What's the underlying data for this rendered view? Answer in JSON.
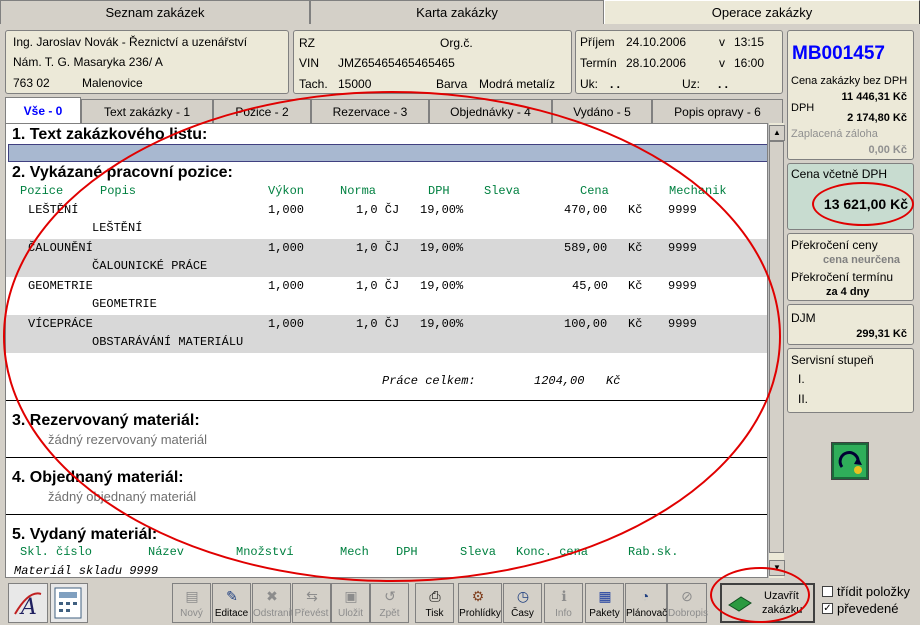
{
  "top_tabs": [
    "Seznam zakázek",
    "Karta zakázky",
    "Operace zakázky"
  ],
  "customer": {
    "name": "Ing. Jaroslav Novák - Řeznictví a uzenářství",
    "street": "Nám. T. G. Masaryka 236/ A",
    "zip": "763 02",
    "city": "Malenovice"
  },
  "vehicle": {
    "rz_label": "RZ",
    "orgc_label": "Org.č.",
    "vin_label": "VIN",
    "vin": "JMZ65465465465465",
    "tach_label": "Tach.",
    "tach": "15000",
    "barva_label": "Barva",
    "barva": "Modrá metalíz"
  },
  "dates": {
    "prijem_label": "Příjem",
    "prijem_date": "24.10.2006",
    "v1": "v",
    "prijem_time": "13:15",
    "termin_label": "Termín",
    "termin_date": "28.10.2006",
    "v2": "v",
    "termin_time": "16:00",
    "uk_label": "Uk:",
    "uk_val": ". .",
    "uz_label": "Uz:",
    "uz_val": ". ."
  },
  "order": {
    "number": "MB001457",
    "bez_dph_label": "Cena zakázky bez DPH",
    "bez_dph": "11 446,31 Kč",
    "dph_label": "DPH",
    "dph": "2 174,80 Kč",
    "zaloha_label": "Zaplacená záloha",
    "zaloha": "0,00 Kč",
    "vcetne_label": "Cena včetně DPH",
    "vcetne": "13 621,00 Kč",
    "prekroceni_ceny_label": "Překročení ceny",
    "prekroceni_ceny": "cena neurčena",
    "prekroceni_terminu_label": "Překročení termínu",
    "prekroceni_terminu": "za 4 dny",
    "djm_label": "DJM",
    "djm": "299,31 Kč",
    "servis_label": "Servisní stupeň",
    "servis_i": "I.",
    "servis_ii": "II."
  },
  "sub_tabs": [
    "Vše - 0",
    "Text zakázky - 1",
    "Pozice - 2",
    "Rezervace - 3",
    "Objednávky - 4",
    "Vydáno - 5",
    "Popis opravy - 6"
  ],
  "sections": {
    "s1": "1.  Text zakázkového listu:",
    "s2": "2.  Vykázané pracovní pozice:",
    "s3": "3.  Rezervovaný materiál:",
    "s3_empty": "žádný rezervovaný materiál",
    "s4": "4.  Objednaný materiál:",
    "s4_empty": "žádný objednaný materiál",
    "s5": "5.  Vydaný materiál:"
  },
  "positions_header": {
    "pozice": "Pozice",
    "popis": "Popis",
    "vykon": "Výkon",
    "norma": "Norma",
    "dph": "DPH",
    "sleva": "Sleva",
    "cena": "Cena",
    "mechanik": "Mechanik"
  },
  "positions": [
    {
      "pozice": "LEŠTĚNÍ",
      "popis": "LEŠTĚNÍ",
      "vykon": "1,000",
      "norma": "1,0 ČJ",
      "dph": "19,00%",
      "cena": "470,00",
      "mena": "Kč",
      "mechanik": "9999"
    },
    {
      "pozice": "ČALOUNĚNÍ",
      "popis": "ČALOUNICKÉ PRÁCE",
      "vykon": "1,000",
      "norma": "1,0 ČJ",
      "dph": "19,00%",
      "cena": "589,00",
      "mena": "Kč",
      "mechanik": "9999"
    },
    {
      "pozice": "GEOMETRIE",
      "popis": "GEOMETRIE",
      "vykon": "1,000",
      "norma": "1,0 ČJ",
      "dph": "19,00%",
      "cena": "45,00",
      "mena": "Kč",
      "mechanik": "9999"
    },
    {
      "pozice": "VÍCEPRÁCE",
      "popis": "OBSTARÁVÁNÍ MATERIÁLU",
      "vykon": "1,000",
      "norma": "1,0 ČJ",
      "dph": "19,00%",
      "cena": "100,00",
      "mena": "Kč",
      "mechanik": "9999"
    }
  ],
  "total": {
    "label": "Práce celkem:",
    "value": "1204,00",
    "mena": "Kč"
  },
  "material_header": {
    "skl": "Skl. číslo",
    "nazev": "Název",
    "mnozstvi": "Množství",
    "mech": "Mech",
    "dph": "DPH",
    "sleva": "Sleva",
    "konc": "Konc. cena",
    "rab": "Rab.sk."
  },
  "material_row": "Materiál skladu 9999",
  "toolbar": {
    "novy": "Nový",
    "editace": "Editace",
    "odstranit": "Odstranit",
    "prevest": "Převést",
    "ulozit": "Uložit",
    "zpet": "Zpět",
    "tisk": "Tisk",
    "prohlidky": "Prohlídky",
    "casy": "Časy",
    "info": "Info",
    "pakety": "Pakety",
    "planovac": "Plánovač",
    "dobropis": "Dobropis",
    "uzavrit1": "Uzavřít",
    "uzavrit2": "zakázku",
    "tridit": "třídit položky",
    "prevedene": "převedené"
  },
  "colors": {
    "order_number": "#0000ff",
    "header_green": "#008040",
    "annotation": "#e00000"
  }
}
